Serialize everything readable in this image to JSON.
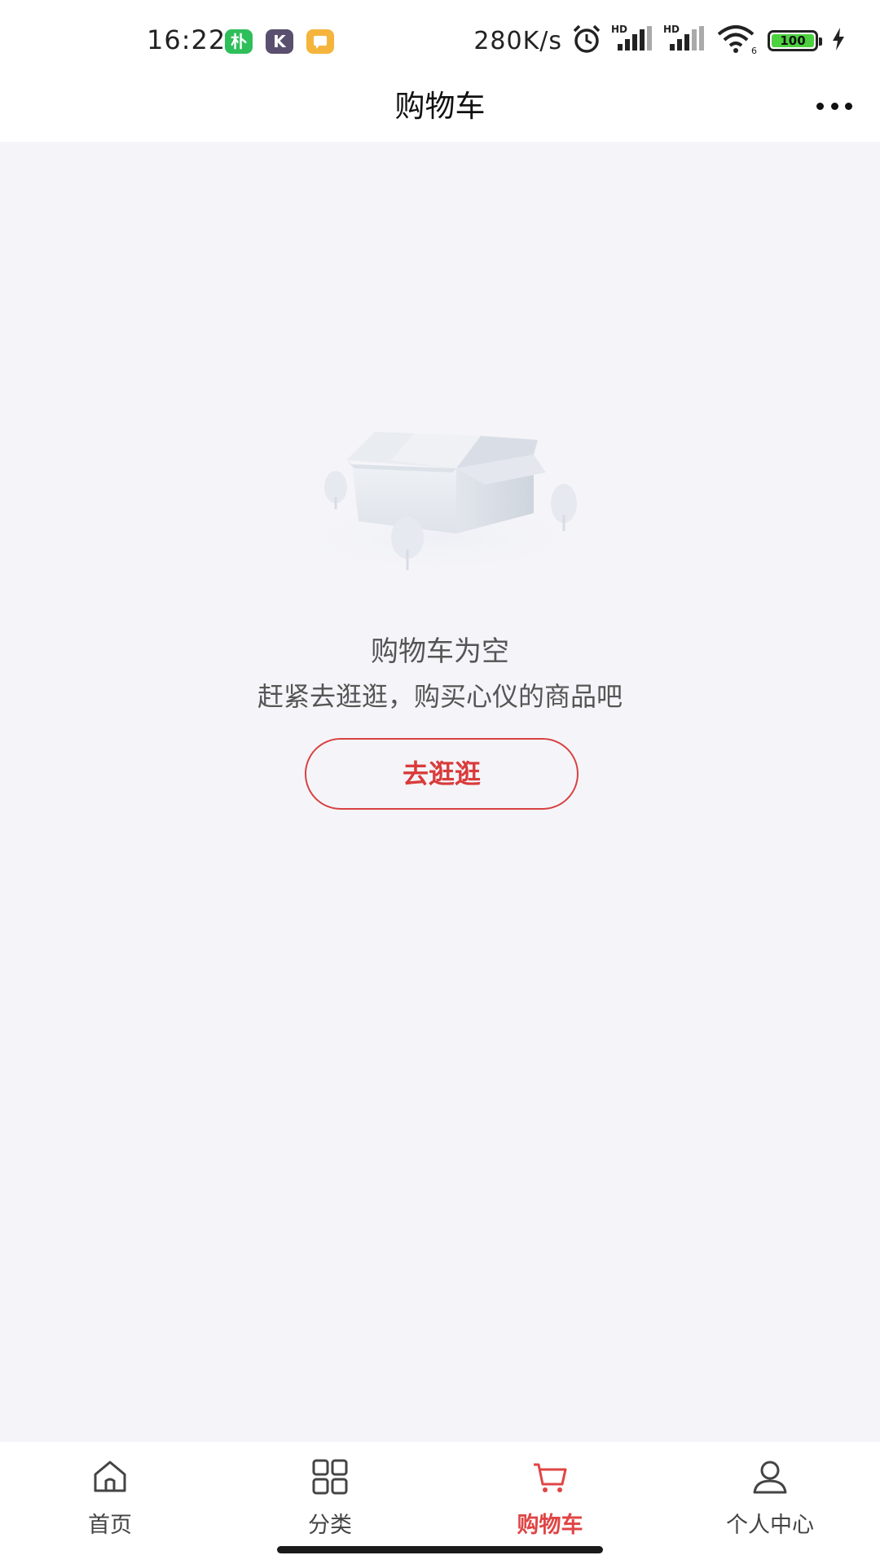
{
  "status_bar": {
    "time": "16:22",
    "app_icons": [
      {
        "name": "pu-app-icon",
        "label": "朴",
        "color": "#2fbf5a"
      },
      {
        "name": "k-app-icon",
        "label": "K",
        "color": "#5a4f6e"
      },
      {
        "name": "message-app-icon",
        "label": "",
        "color": "#f5b53c"
      }
    ],
    "network_speed": "280K/s",
    "battery_level": "100",
    "signal_label": "HD",
    "wifi_label": "6"
  },
  "header": {
    "title": "购物车",
    "more_icon": "more-dots-icon"
  },
  "empty_state": {
    "illustration": "empty-box-icon",
    "title": "购物车为空",
    "subtitle": "赶紧去逛逛，购买心仪的商品吧",
    "button_label": "去逛逛"
  },
  "tabbar": {
    "active_color": "#e04545",
    "items": [
      {
        "label": "首页",
        "icon": "home-icon",
        "active": false
      },
      {
        "label": "分类",
        "icon": "grid-icon",
        "active": false
      },
      {
        "label": "购物车",
        "icon": "cart-icon",
        "active": true
      },
      {
        "label": "个人中心",
        "icon": "user-icon",
        "active": false
      }
    ]
  }
}
